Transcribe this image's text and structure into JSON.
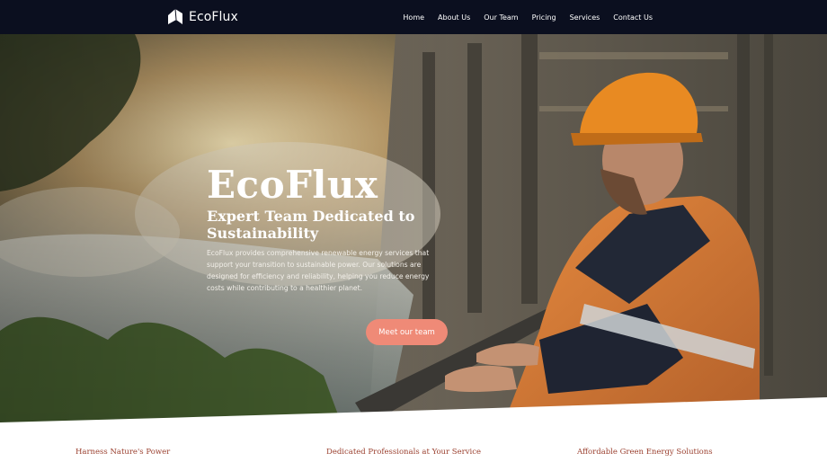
{
  "brand": {
    "name": "EcoFlux",
    "logo_icon": "house-leaf-icon"
  },
  "nav": {
    "items": [
      {
        "label": "Home"
      },
      {
        "label": "About Us"
      },
      {
        "label": "Our Team"
      },
      {
        "label": "Pricing"
      },
      {
        "label": "Services"
      },
      {
        "label": "Contact Us"
      }
    ]
  },
  "hero": {
    "title": "EcoFlux",
    "subtitle": "Expert Team Dedicated to Sustainability",
    "description": "EcoFlux provides comprehensive renewable energy services that support your transition to sustainable power. Our solutions are designed for efficiency and reliability, helping you reduce energy costs while contributing to a healthier planet.",
    "cta_label": "Meet our team"
  },
  "features": [
    {
      "title": "Harness Nature's Power"
    },
    {
      "title": "Dedicated Professionals at Your Service"
    },
    {
      "title": "Affordable Green Energy Solutions"
    }
  ],
  "colors": {
    "nav_bg": "#0b0f1f",
    "accent": "#ef8a77",
    "feature_title": "#9a3f2e"
  }
}
